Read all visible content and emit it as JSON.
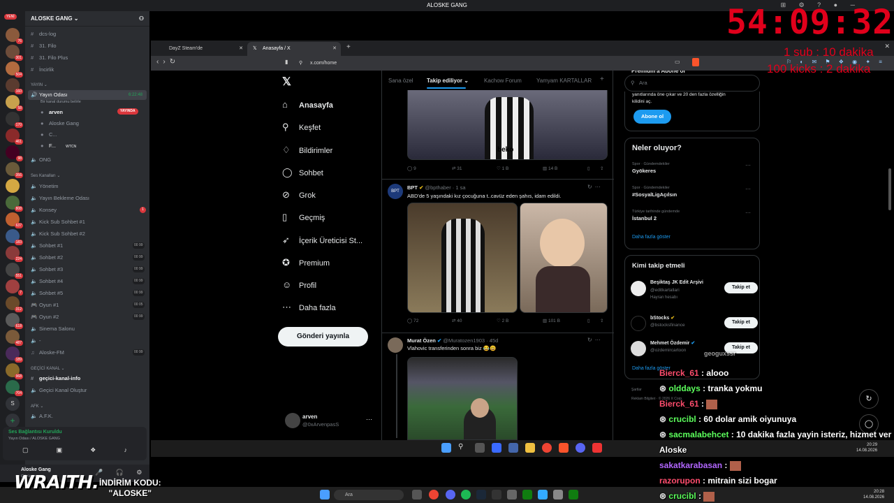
{
  "window_title": "ALOSKE GANG",
  "timer": "54:09:32",
  "subgoal": [
    "1 sub : 10 dakika",
    "100 kicks : 2 dakika"
  ],
  "discord": {
    "new_badge": "YENİ",
    "server_name": "ALOSKE GANG",
    "channels_top": [
      "dcs-log",
      "31. Filo",
      "31. Filo Plus",
      "İncirlik"
    ],
    "cat_yayin": "YAYIN",
    "yayin_odasi": "Yayın Odası",
    "yayin_time": "6:22:48",
    "yayin_status": "Bir kanal durumu belirle",
    "members": [
      "arven",
      "Aloske Gang",
      "C...",
      "F..."
    ],
    "live_label": "YAYINDA",
    "wtcn": "WTCN",
    "ong": "ONG",
    "cat_ses": "Ses Kanalları",
    "voice_channels": [
      "Yönetim",
      "Yayın Bekleme Odası",
      "Konsey",
      "Kick Sub Sohbet #1",
      "Kick Sub Sohbet #2",
      "Sohbet #1",
      "Sohbet #2",
      "Sohbet #3",
      "Sohbet #4",
      "Sohbet #5",
      "Oyun #1",
      "Oyun #2",
      "Sinema Salonu",
      "-",
      "Aloske-FM"
    ],
    "counts": [
      "00 99",
      "00 99",
      "00 99",
      "00 99",
      "00 99",
      "00 05",
      "00 99",
      "00 99"
    ],
    "konsey_badge": "1",
    "cat_gecici": "GEÇİCİ KANAL",
    "gecici_info": "geçici-kanal-info",
    "gecici_create": "Geçici Kanal Oluştur",
    "cat_afk": "AFK",
    "afk": "A.F.K.",
    "voice_connected": "Ses Bağlantısı Kuruldu",
    "voice_location": "Yayın Odası / ALOSKE GANG",
    "user_name": "Aloske Gang",
    "user_status": "Görünmez"
  },
  "browser": {
    "tab1": "DayZ Steam'de",
    "tab2": "Anasayfa / X",
    "url": "x.com/home"
  },
  "x": {
    "nav": [
      "Anasayfa",
      "Keşfet",
      "Bildirimler",
      "Sohbet",
      "Grok",
      "Geçmiş",
      "İçerik Üreticisi St...",
      "Premium",
      "Profil",
      "Daha fazla"
    ],
    "post_button": "Gönderi yayınla",
    "account_name": "arven",
    "account_handle": "@0xArvenpasS",
    "feed_tabs": [
      "Sana özel",
      "Takip ediliyor",
      "Kachow Forum",
      "Yamyam KARTALLAR"
    ],
    "tweet0_actions": [
      "9",
      "31",
      "1 B",
      "14 B"
    ],
    "tweet1": {
      "name": "BPT",
      "handle": "@bpthaber · 1 sa",
      "text": "ABD'de 5 yaşındaki kız çocuğuna t..cavüz eden şahıs, idam edildi.",
      "actions": [
        "72",
        "40",
        "2 B",
        "101 B"
      ]
    },
    "tweet2": {
      "name": "Murat Özen",
      "handle": "@Muratozen1903 · 45d",
      "text": "Vlahovic transferinden sonra biz 😂😃"
    },
    "search_placeholder": "Ara",
    "premium_title": "Premium'a Abone ol",
    "premium_text": [
      "yanıtlarında öne çıkar ve 20 den fazla özelliğin",
      "kilidini aç."
    ],
    "premium_btn": "Abone ol",
    "trends_title": "Neler oluyor?",
    "trends": [
      {
        "sub": "Spor · Gündemdekiler",
        "tag": "Gyökeres"
      },
      {
        "sub": "Spor · Gündemdekiler",
        "tag": "#SosyalLigAçılsın"
      },
      {
        "sub": "Türkiye tarihinde gündemde",
        "tag": "İstanbul 2"
      }
    ],
    "show_more": "Daha fazla göster",
    "follow_title": "Kimi takip etmeli",
    "follow": [
      {
        "name": "Beşiktaş JK Edit Arşivi",
        "handle": "@editkartallari",
        "sub": "Hayran hesabı"
      },
      {
        "name": "bStocks",
        "handle": "@bstocksfinance",
        "sub": ""
      },
      {
        "name": "Mehmet Özdemir",
        "handle": "@ozdemircartoon",
        "sub": ""
      }
    ],
    "follow_btn": "Takip et",
    "footer": [
      "Şartlar",
      "Reklam Bilgileri",
      "© 2026 X Corp."
    ]
  },
  "chat": [
    {
      "user": "geoguxssr",
      "msg": "",
      "color": "#ffffff"
    },
    {
      "user": "Bierck_61",
      "msg": "alooo",
      "color": "#ff4d6d"
    },
    {
      "user": "olddays",
      "msg": "tranka yokmu",
      "color": "#5cff5c"
    },
    {
      "user": "Bierck_61",
      "msg": "",
      "color": "#ff4d6d"
    },
    {
      "user": "crucibl",
      "msg": "60 dolar amik oiyunuya",
      "color": "#5cff5c"
    },
    {
      "user": "sacmalabehcet",
      "msg": "10 dakika fazla yayin isteriz, hizmet ver",
      "color": "#5cff5c"
    },
    {
      "user": "",
      "msg": "Aloske",
      "color": "#ffffff"
    },
    {
      "user": "sakatkarabasan",
      "msg": "",
      "color": "#b266ff"
    },
    {
      "user": "razorupon",
      "msg": "mitrain sizi bogar",
      "color": "#ff4d6d"
    },
    {
      "user": "crucibl",
      "msg": "",
      "color": "#5cff5c"
    }
  ],
  "taskbar": {
    "search": "Ara",
    "time": "20:28",
    "date": "14.08.2026",
    "time2": "20:29",
    "date2": "14.08.2026"
  },
  "overlay": {
    "brand": "WRAITH.",
    "promo_line1": "İNDİRİM KODU:",
    "promo_line2": "\"ALOSKE\""
  }
}
